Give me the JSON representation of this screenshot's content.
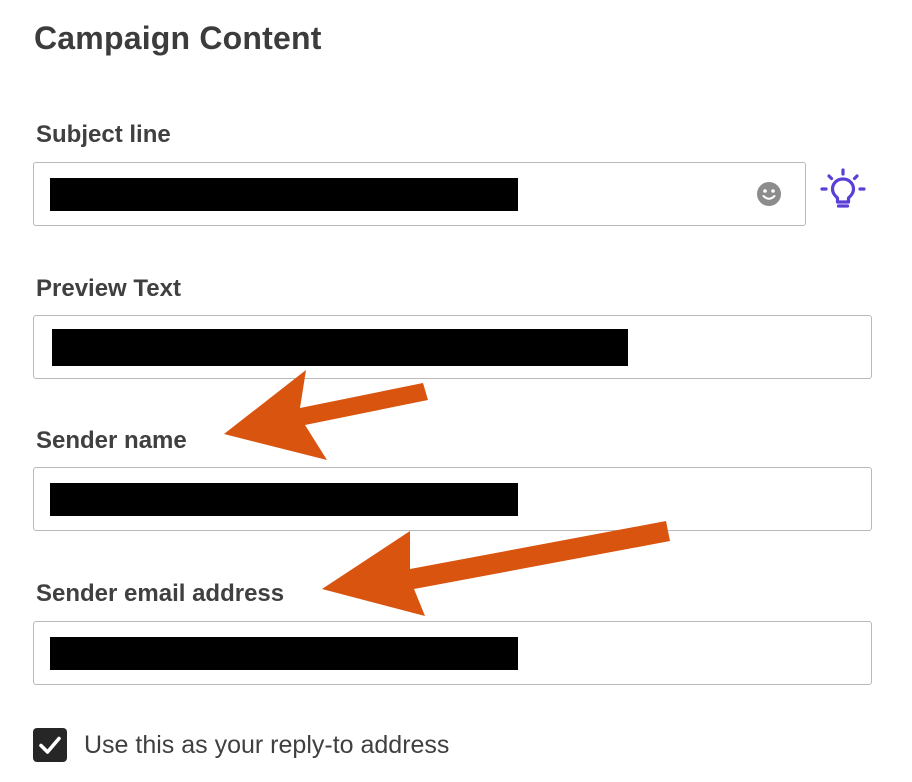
{
  "page": {
    "title": "Campaign Content"
  },
  "fields": {
    "subject": {
      "label": "Subject line",
      "value": ""
    },
    "preview": {
      "label": "Preview Text",
      "value": ""
    },
    "sender_name": {
      "label": "Sender name",
      "value": ""
    },
    "sender_email": {
      "label": "Sender email address",
      "value": ""
    }
  },
  "reply_to": {
    "label": "Use this as your reply-to address",
    "checked": true
  },
  "icons": {
    "emoji": "smiley-face-icon",
    "tips": "lightbulb-icon",
    "annotation": "arrow-icon"
  },
  "colors": {
    "accent": "#5b3fd6",
    "annotation_arrow": "#d9540e",
    "redaction": "#000000",
    "checkbox": "#262626"
  }
}
